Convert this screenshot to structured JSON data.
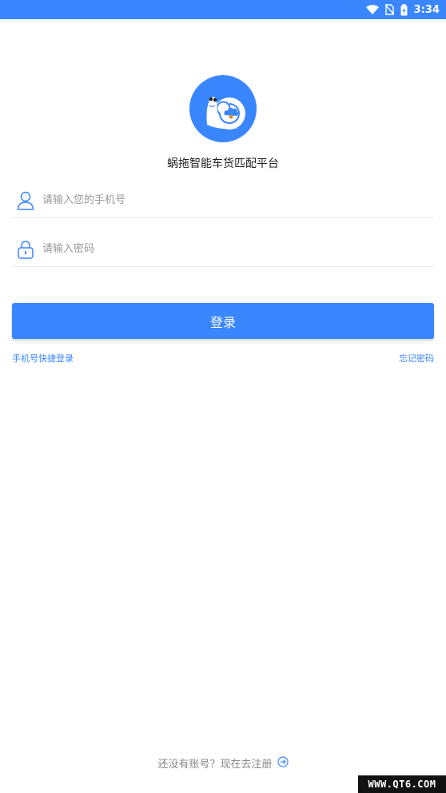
{
  "status_bar": {
    "time": "3:34",
    "icons": [
      "wifi-icon",
      "no-sim-icon",
      "battery-charging-icon"
    ],
    "color": "#3a86ff"
  },
  "app": {
    "logo_icon": "snail-logo-icon",
    "title": "蜗拖智能车货匹配平台"
  },
  "form": {
    "phone": {
      "icon": "user-icon",
      "placeholder": "请输入您的手机号",
      "value": ""
    },
    "password": {
      "icon": "lock-icon",
      "placeholder": "请输入密码",
      "value": ""
    },
    "login_label": "登录"
  },
  "links": {
    "quick_login": "手机号快捷登录",
    "forgot_password": "忘记密码"
  },
  "register": {
    "text": "还没有账号？现在去注册",
    "icon": "arrow-right-circle-icon"
  },
  "watermark": "WWW.QT6.COM",
  "colors": {
    "accent": "#3a86ff",
    "link": "#3a86ff",
    "muted": "#888888"
  }
}
